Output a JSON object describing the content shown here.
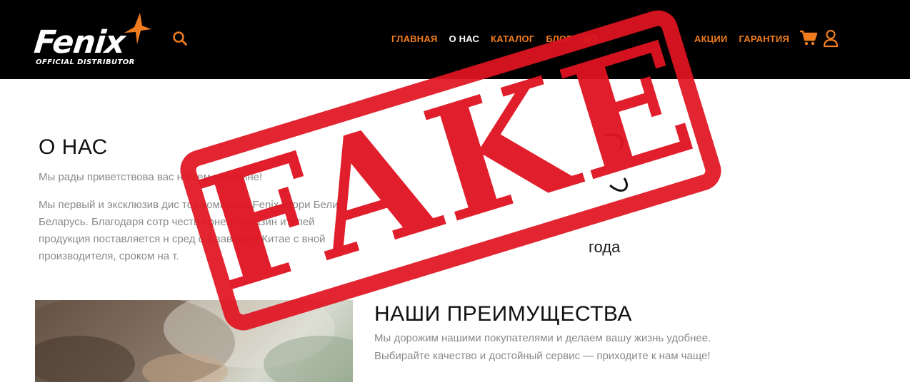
{
  "header": {
    "logo": {
      "brand": "Fenix",
      "tagline": "OFFICIAL DISTRIBUTOR"
    },
    "nav": [
      {
        "label": "ГЛАВНАЯ",
        "active": false
      },
      {
        "label": "О НАС",
        "active": true
      },
      {
        "label": "КАТАЛОГ",
        "active": false
      },
      {
        "label": "БЛОГ",
        "active": false
      },
      {
        "label": "ДО",
        "active": false
      }
    ],
    "nav_right": [
      {
        "label": "АКЦИИ"
      },
      {
        "label": "ГАРАНТИЯ"
      }
    ],
    "icons": {
      "search": "search-icon",
      "cart": "cart-icon",
      "user": "user-icon"
    }
  },
  "about": {
    "title": "О НАС",
    "greeting": "Мы рады приветствова  вас      нашем  магазине!",
    "text_lines": [
      "Мы первый и эксклюзив    дис     тор компании Fenix     итори     Бели",
      "Беларусь. Благодаря сотр    честв      ерне  т-магазин     ителей",
      "продукция поставляется н     сред       о с завода в Китае с    вной",
      "производителя, сроком на     т."
    ],
    "years_label": "года"
  },
  "advantages": {
    "title": "НАШИ ПРЕИМУЩЕСТВА",
    "line1": "Мы дорожим нашими покупателями и делаем вашу жизнь удобнее.",
    "line2": "Выбирайте качество и достойный сервис — приходите к нам чаще!"
  },
  "stamp": {
    "text": "FAKE",
    "color": "#e01421"
  },
  "colors": {
    "header_bg": "#000000",
    "accent": "#f07c1f",
    "nav_active": "#ffffff",
    "body_text": "#8a8a8a",
    "heading_text": "#111111"
  }
}
